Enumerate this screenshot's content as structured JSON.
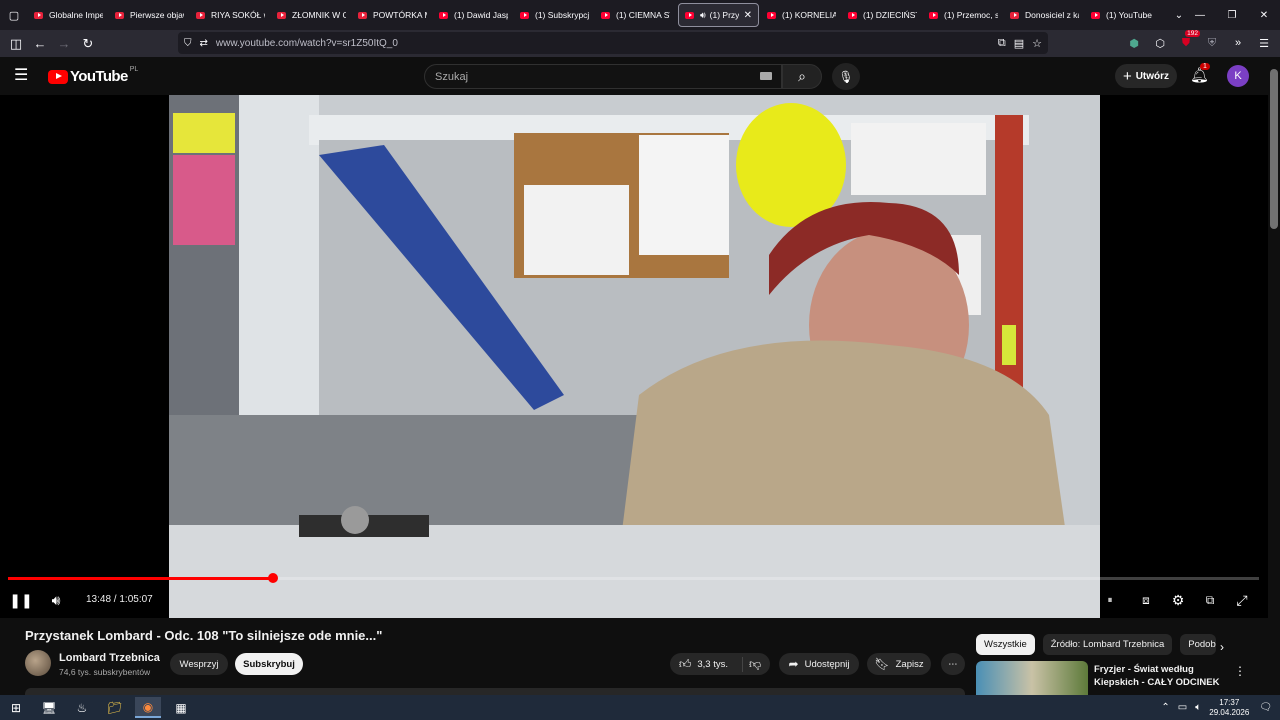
{
  "browser": {
    "tabs": [
      {
        "label": "Globalne Impe",
        "active": false
      },
      {
        "label": "Pierwsze objaw",
        "active": false
      },
      {
        "label": "RIYA SOKÓŁ w",
        "active": false
      },
      {
        "label": "ZŁOMNIK W C",
        "active": false
      },
      {
        "label": "POWTÓRKA M",
        "active": false
      },
      {
        "label": "(1) Dawid Jasp",
        "active": false
      },
      {
        "label": "(1) Subskrypcje",
        "active": false
      },
      {
        "label": "(1) CIEMNA ST",
        "active": false
      },
      {
        "label": "(1) Przy",
        "active": true
      },
      {
        "label": "(1) KORNELIA",
        "active": false
      },
      {
        "label": "(1) DZIECIŃSTW",
        "active": false
      },
      {
        "label": "(1) Przemoc, s",
        "active": false
      },
      {
        "label": "Donosiciel z ka",
        "active": false
      },
      {
        "label": "(1) YouTube",
        "active": false
      }
    ],
    "url": "www.youtube.com/watch?v=sr1Z50ItQ_0",
    "extension_badge": "192"
  },
  "youtube": {
    "logo_text": "YouTube",
    "logo_region": "PL",
    "search_placeholder": "Szukaj",
    "create_label": "Utwórz",
    "notifications_count": "1",
    "avatar_letter": "K"
  },
  "player": {
    "current_time": "13:48",
    "duration": "1:05:07",
    "time_display": "13:48 / 1:05:07",
    "progress_fraction": 0.212,
    "state": "playing"
  },
  "video": {
    "title": "Przystanek Lombard - Odc. 108 \"To silniejsze ode mnie...\"",
    "channel": "Lombard Trzebnica",
    "subscribers": "74,6 tys. subskrybentów",
    "support_label": "Wesprzyj",
    "subscribe_label": "Subskrybuj",
    "likes": "3,3 tys.",
    "share_label": "Udostępnij",
    "save_label": "Zapisz"
  },
  "sidebar": {
    "chips": [
      "Wszystkie",
      "Źródło: Lombard Trzebnica",
      "Podob"
    ],
    "recommendation": {
      "title": "Fryzjer - Świat według Kiepskich - CAŁY ODCINEK ..."
    }
  },
  "taskbar": {
    "time": "17:37",
    "date": "29.04.2026"
  },
  "colors": {
    "accent_red": "#ff0000",
    "background": "#0f0f0f",
    "avatar_purple": "#7b3fc4"
  }
}
